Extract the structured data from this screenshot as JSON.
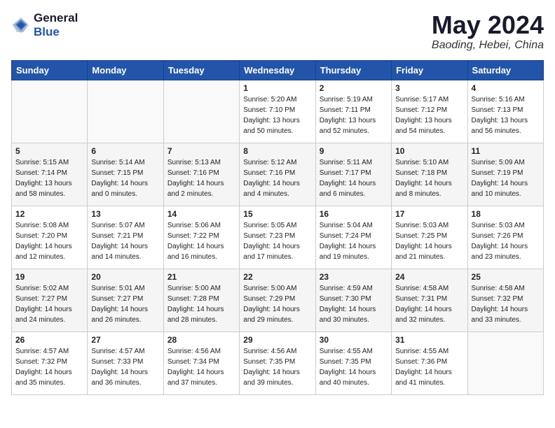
{
  "logo": {
    "general": "General",
    "blue": "Blue"
  },
  "title": {
    "month_year": "May 2024",
    "location": "Baoding, Hebei, China"
  },
  "headers": [
    "Sunday",
    "Monday",
    "Tuesday",
    "Wednesday",
    "Thursday",
    "Friday",
    "Saturday"
  ],
  "weeks": [
    [
      {
        "day": "",
        "info": ""
      },
      {
        "day": "",
        "info": ""
      },
      {
        "day": "",
        "info": ""
      },
      {
        "day": "1",
        "info": "Sunrise: 5:20 AM\nSunset: 7:10 PM\nDaylight: 13 hours\nand 50 minutes."
      },
      {
        "day": "2",
        "info": "Sunrise: 5:19 AM\nSunset: 7:11 PM\nDaylight: 13 hours\nand 52 minutes."
      },
      {
        "day": "3",
        "info": "Sunrise: 5:17 AM\nSunset: 7:12 PM\nDaylight: 13 hours\nand 54 minutes."
      },
      {
        "day": "4",
        "info": "Sunrise: 5:16 AM\nSunset: 7:13 PM\nDaylight: 13 hours\nand 56 minutes."
      }
    ],
    [
      {
        "day": "5",
        "info": "Sunrise: 5:15 AM\nSunset: 7:14 PM\nDaylight: 13 hours\nand 58 minutes."
      },
      {
        "day": "6",
        "info": "Sunrise: 5:14 AM\nSunset: 7:15 PM\nDaylight: 14 hours\nand 0 minutes."
      },
      {
        "day": "7",
        "info": "Sunrise: 5:13 AM\nSunset: 7:16 PM\nDaylight: 14 hours\nand 2 minutes."
      },
      {
        "day": "8",
        "info": "Sunrise: 5:12 AM\nSunset: 7:16 PM\nDaylight: 14 hours\nand 4 minutes."
      },
      {
        "day": "9",
        "info": "Sunrise: 5:11 AM\nSunset: 7:17 PM\nDaylight: 14 hours\nand 6 minutes."
      },
      {
        "day": "10",
        "info": "Sunrise: 5:10 AM\nSunset: 7:18 PM\nDaylight: 14 hours\nand 8 minutes."
      },
      {
        "day": "11",
        "info": "Sunrise: 5:09 AM\nSunset: 7:19 PM\nDaylight: 14 hours\nand 10 minutes."
      }
    ],
    [
      {
        "day": "12",
        "info": "Sunrise: 5:08 AM\nSunset: 7:20 PM\nDaylight: 14 hours\nand 12 minutes."
      },
      {
        "day": "13",
        "info": "Sunrise: 5:07 AM\nSunset: 7:21 PM\nDaylight: 14 hours\nand 14 minutes."
      },
      {
        "day": "14",
        "info": "Sunrise: 5:06 AM\nSunset: 7:22 PM\nDaylight: 14 hours\nand 16 minutes."
      },
      {
        "day": "15",
        "info": "Sunrise: 5:05 AM\nSunset: 7:23 PM\nDaylight: 14 hours\nand 17 minutes."
      },
      {
        "day": "16",
        "info": "Sunrise: 5:04 AM\nSunset: 7:24 PM\nDaylight: 14 hours\nand 19 minutes."
      },
      {
        "day": "17",
        "info": "Sunrise: 5:03 AM\nSunset: 7:25 PM\nDaylight: 14 hours\nand 21 minutes."
      },
      {
        "day": "18",
        "info": "Sunrise: 5:03 AM\nSunset: 7:26 PM\nDaylight: 14 hours\nand 23 minutes."
      }
    ],
    [
      {
        "day": "19",
        "info": "Sunrise: 5:02 AM\nSunset: 7:27 PM\nDaylight: 14 hours\nand 24 minutes."
      },
      {
        "day": "20",
        "info": "Sunrise: 5:01 AM\nSunset: 7:27 PM\nDaylight: 14 hours\nand 26 minutes."
      },
      {
        "day": "21",
        "info": "Sunrise: 5:00 AM\nSunset: 7:28 PM\nDaylight: 14 hours\nand 28 minutes."
      },
      {
        "day": "22",
        "info": "Sunrise: 5:00 AM\nSunset: 7:29 PM\nDaylight: 14 hours\nand 29 minutes."
      },
      {
        "day": "23",
        "info": "Sunrise: 4:59 AM\nSunset: 7:30 PM\nDaylight: 14 hours\nand 30 minutes."
      },
      {
        "day": "24",
        "info": "Sunrise: 4:58 AM\nSunset: 7:31 PM\nDaylight: 14 hours\nand 32 minutes."
      },
      {
        "day": "25",
        "info": "Sunrise: 4:58 AM\nSunset: 7:32 PM\nDaylight: 14 hours\nand 33 minutes."
      }
    ],
    [
      {
        "day": "26",
        "info": "Sunrise: 4:57 AM\nSunset: 7:32 PM\nDaylight: 14 hours\nand 35 minutes."
      },
      {
        "day": "27",
        "info": "Sunrise: 4:57 AM\nSunset: 7:33 PM\nDaylight: 14 hours\nand 36 minutes."
      },
      {
        "day": "28",
        "info": "Sunrise: 4:56 AM\nSunset: 7:34 PM\nDaylight: 14 hours\nand 37 minutes."
      },
      {
        "day": "29",
        "info": "Sunrise: 4:56 AM\nSunset: 7:35 PM\nDaylight: 14 hours\nand 39 minutes."
      },
      {
        "day": "30",
        "info": "Sunrise: 4:55 AM\nSunset: 7:35 PM\nDaylight: 14 hours\nand 40 minutes."
      },
      {
        "day": "31",
        "info": "Sunrise: 4:55 AM\nSunset: 7:36 PM\nDaylight: 14 hours\nand 41 minutes."
      },
      {
        "day": "",
        "info": ""
      }
    ]
  ]
}
